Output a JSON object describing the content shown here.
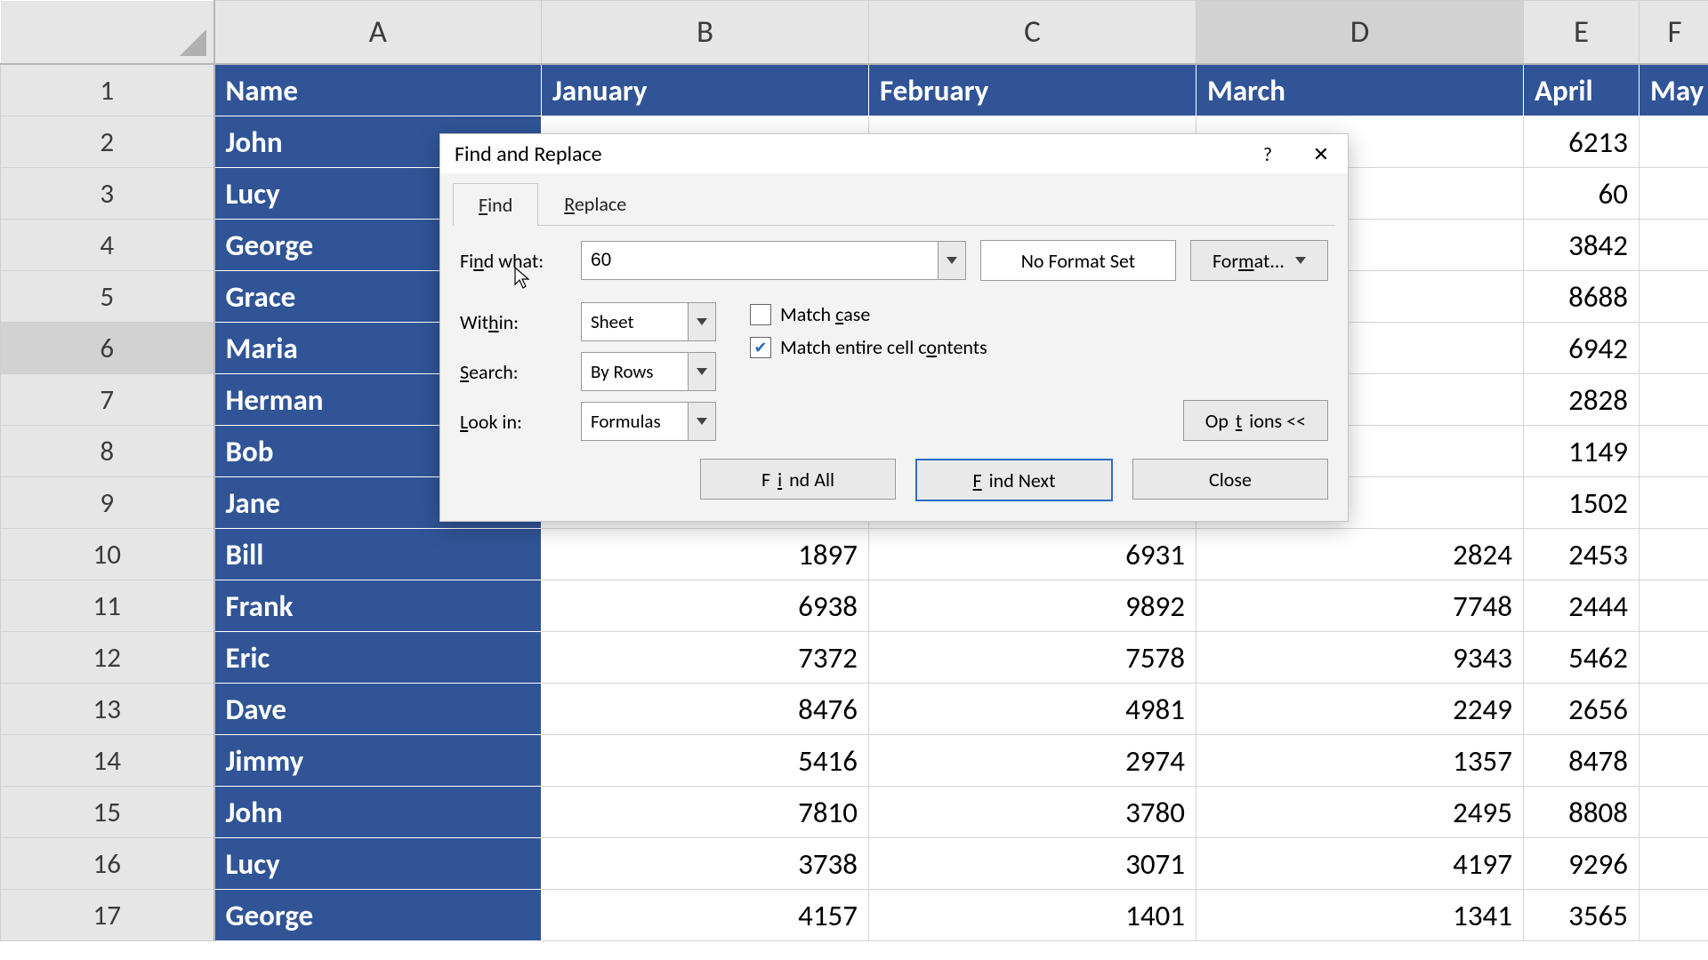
{
  "columns": [
    "A",
    "B",
    "C",
    "D",
    "E",
    "F"
  ],
  "selectedCol": "D",
  "selectedRow": 6,
  "headers": [
    "Name",
    "January",
    "February",
    "March",
    "April",
    "May"
  ],
  "rows": [
    {
      "name": "John",
      "jan": "",
      "feb": "",
      "mar": "",
      "apr": "6213"
    },
    {
      "name": "Lucy",
      "jan": "",
      "feb": "",
      "mar": "",
      "apr": "60"
    },
    {
      "name": "George",
      "jan": "",
      "feb": "",
      "mar": "",
      "apr": "3842"
    },
    {
      "name": "Grace",
      "jan": "",
      "feb": "",
      "mar": "",
      "apr": "8688"
    },
    {
      "name": "Maria",
      "jan": "",
      "feb": "",
      "mar": "",
      "apr": "6942"
    },
    {
      "name": "Herman",
      "jan": "",
      "feb": "",
      "mar": "",
      "apr": "2828"
    },
    {
      "name": "Bob",
      "jan": "",
      "feb": "",
      "mar": "",
      "apr": "1149"
    },
    {
      "name": "Jane",
      "jan": "",
      "feb": "",
      "mar": "",
      "apr": "1502"
    },
    {
      "name": "Bill",
      "jan": "1897",
      "feb": "6931",
      "mar": "2824",
      "apr": "2453"
    },
    {
      "name": "Frank",
      "jan": "6938",
      "feb": "9892",
      "mar": "7748",
      "apr": "2444"
    },
    {
      "name": "Eric",
      "jan": "7372",
      "feb": "7578",
      "mar": "9343",
      "apr": "5462"
    },
    {
      "name": "Dave",
      "jan": "8476",
      "feb": "4981",
      "mar": "2249",
      "apr": "2656"
    },
    {
      "name": "Jimmy",
      "jan": "5416",
      "feb": "2974",
      "mar": "1357",
      "apr": "8478"
    },
    {
      "name": "John",
      "jan": "7810",
      "feb": "3780",
      "mar": "2495",
      "apr": "8808"
    },
    {
      "name": "Lucy",
      "jan": "3738",
      "feb": "3071",
      "mar": "4197",
      "apr": "9296"
    },
    {
      "name": "George",
      "jan": "4157",
      "feb": "1401",
      "mar": "1341",
      "apr": "3565"
    }
  ],
  "dialog": {
    "title": "Find and Replace",
    "tab_find": "Find",
    "tab_replace": "Replace",
    "findwhat_label": "Find what:",
    "findwhat_value": "60",
    "no_format": "No Format Set",
    "format_btn": "Format...",
    "within_label": "Within:",
    "within_value": "Sheet",
    "search_label": "Search:",
    "search_value": "By Rows",
    "lookin_label": "Look in:",
    "lookin_value": "Formulas",
    "match_case": "Match case",
    "match_entire": "Match entire cell contents",
    "options": "Options <<",
    "findall": "Find All",
    "findnext": "Find Next",
    "close": "Close",
    "help": "?",
    "x": "✕"
  }
}
